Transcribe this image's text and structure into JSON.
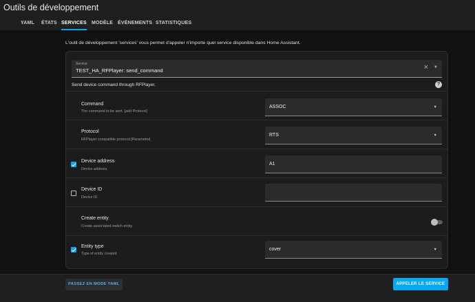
{
  "header": {
    "title": "Outils de développement",
    "tabs": [
      {
        "label": "YAML"
      },
      {
        "label": "ÉTATS"
      },
      {
        "label": "SERVICES",
        "active": true
      },
      {
        "label": "MODÈLE"
      },
      {
        "label": "ÉVÉNEMENTS"
      },
      {
        "label": "STATISTIQUES"
      }
    ]
  },
  "intro": "L'outil de développement 'services' vous permet d'appeler n'importe quel service disponible dans Home Assistant.",
  "service": {
    "label": "Service",
    "value": "TEST_HA_RFPlayer: send_command",
    "description": "Send device command through RFPlayer."
  },
  "fields": [
    {
      "name": "Command",
      "description": "The command to be sent. [add Protocol]",
      "value": "ASSOC",
      "control": "select",
      "checkbox": "none"
    },
    {
      "name": "Protocol",
      "description": "RFPlayer compatible protocol.[Parametre]",
      "value": "RTS",
      "control": "select",
      "checkbox": "none"
    },
    {
      "name": "Device address",
      "description": "Device address.",
      "value": "A1",
      "control": "text",
      "checkbox": "checked"
    },
    {
      "name": "Device ID",
      "description": "Device ID.",
      "value": "",
      "control": "text",
      "checkbox": "unchecked"
    },
    {
      "name": "Create entity",
      "description": "Create associated switch entity",
      "value": "off",
      "control": "toggle",
      "checkbox": "none"
    },
    {
      "name": "Entity type",
      "description": "Type of entity created",
      "value": "cover",
      "control": "select",
      "checkbox": "checked"
    }
  ],
  "footer": {
    "yaml_mode_label": "PASSEZ EN MODE YAML",
    "call_service_label": "APPELER LE SERVICE"
  },
  "colors": {
    "accent": "#03a9f4",
    "background": "#111111",
    "card": "#1c1c1c"
  }
}
